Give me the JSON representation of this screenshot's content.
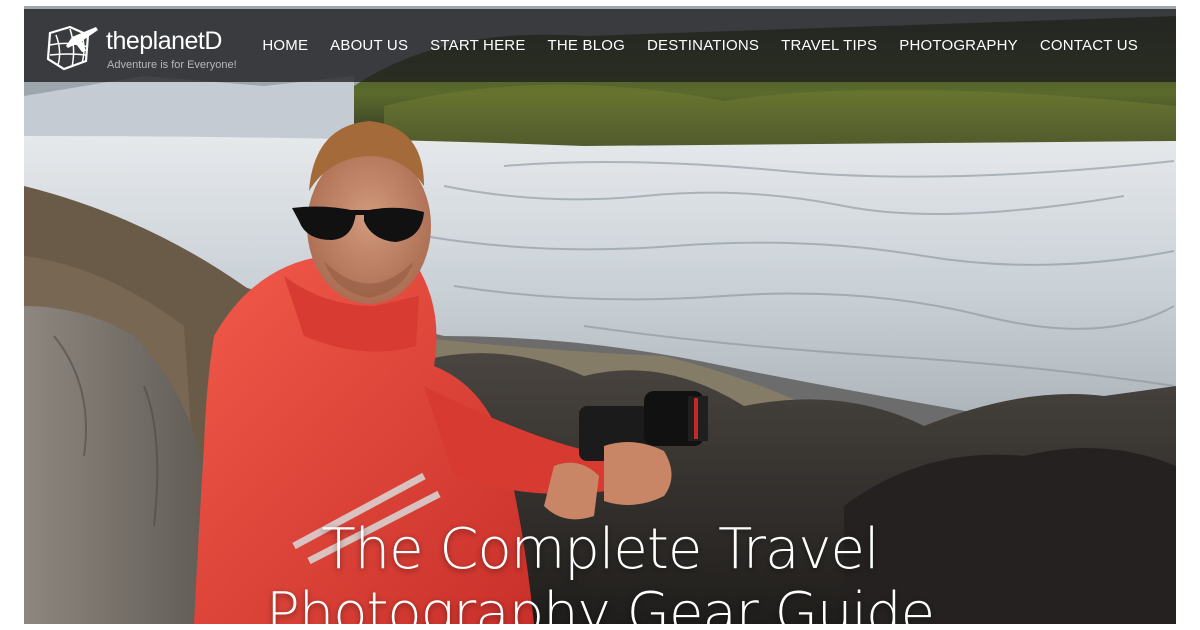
{
  "site": {
    "name": "theplanetD",
    "tagline": "Adventure is for Everyone!"
  },
  "nav": {
    "items": [
      "HOME",
      "ABOUT US",
      "START HERE",
      "THE BLOG",
      "DESTINATIONS",
      "TRAVEL TIPS",
      "PHOTOGRAPHY",
      "CONTACT US"
    ]
  },
  "hero": {
    "title_line1": "The Complete Travel",
    "title_line2": "Photography Gear Guide"
  },
  "colors": {
    "navbar_bg": "#1e1e20",
    "jacket": "#e8443a",
    "glacier": "#d9dde1"
  },
  "icons": {
    "logo": "globe-airplane-logo-icon"
  }
}
